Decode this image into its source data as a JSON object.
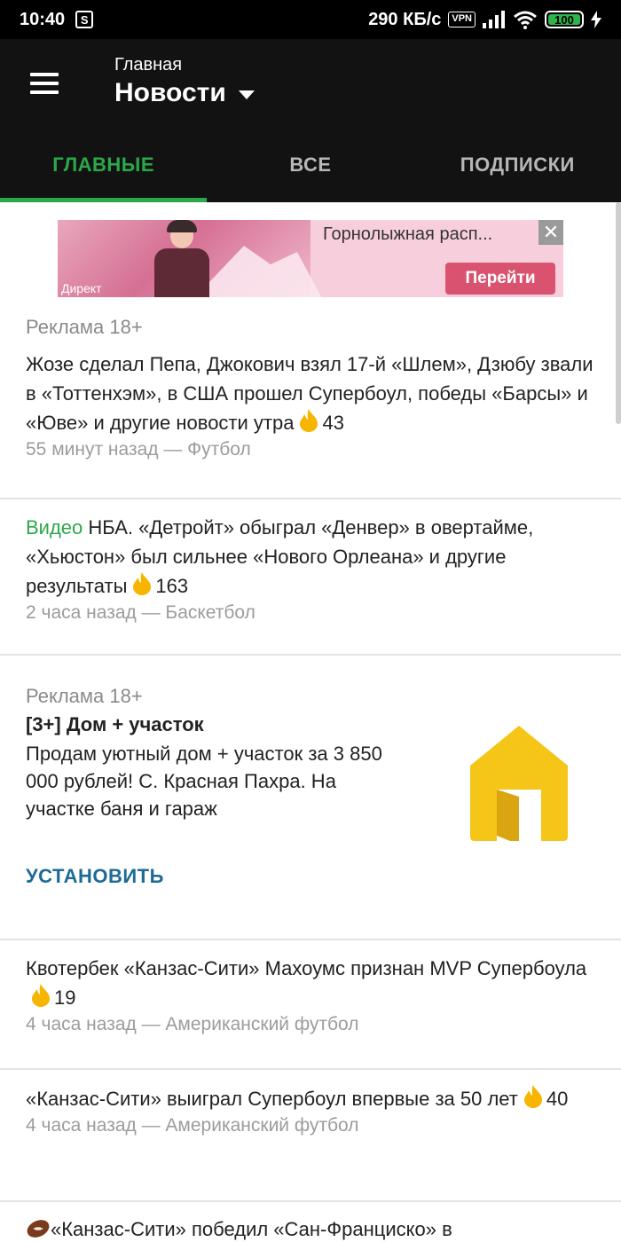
{
  "status_bar": {
    "time": "10:40",
    "sim_icon_text": "S",
    "speed": "290 КБ/с",
    "vpn": "VPN",
    "battery": "100"
  },
  "header": {
    "subtitle": "Главная",
    "title": "Новости",
    "tabs": [
      {
        "label": "ГЛАВНЫЕ",
        "active": true
      },
      {
        "label": "ВСЕ",
        "active": false
      },
      {
        "label": "ПОДПИСКИ",
        "active": false
      }
    ]
  },
  "banner_ad": {
    "source": "Директ",
    "text": "Горнолыжная расп...",
    "button": "Перейти",
    "close": "✕"
  },
  "feed": [
    {
      "ad_label": "Реклама 18+",
      "headline": "Жозе сделал Пепа, Джокович взял 17-й «Шлем», Дзюбу звали в «Тоттенхэм», в США прошел Супербоул, победы «Барсы» и «Юве» и другие новости утра",
      "count": "43",
      "meta": "55 минут назад — Футбол"
    },
    {
      "video_label": "Видео",
      "headline": "НБА. «Детройт» обыграл «Денвер» в овертайме, «Хьюстон» был сильнее «Нового Орлеана» и другие результаты",
      "count": "163",
      "meta": "2 часа назад — Баскетбол"
    },
    {
      "headline": "Квотербек «Канзас-Сити» Махоумс признан MVP Супербоула",
      "count": "19",
      "meta": "4 часа назад — Американский футбол"
    },
    {
      "headline": "«Канзас-Сити» выиграл Супербоул впервые за 50 лет",
      "count": "40",
      "meta": "4 часа назад — Американский футбол"
    },
    {
      "headline": "«Канзас-Сити» победил «Сан-Франциско» в"
    }
  ],
  "native_ad": {
    "ad_label": "Реклама 18+",
    "title": "[3+] Дом + участок",
    "text": "Продам уютный дом + участок за 3 850 000 рублей! С. Красная Пахра. На участке баня и гараж",
    "install": "УСТАНОВИТЬ"
  },
  "colors": {
    "accent_green": "#2aa84a",
    "install_blue": "#1d6b95",
    "banner_button": "#d9526f",
    "house_yellow": "#f5c518"
  }
}
